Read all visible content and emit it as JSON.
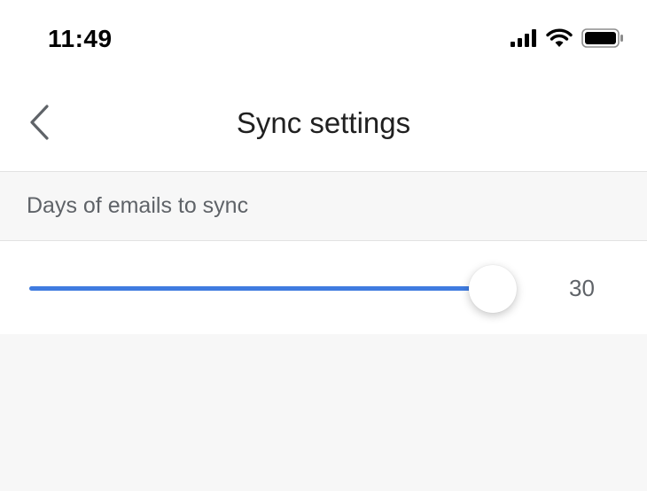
{
  "status_bar": {
    "time": "11:49",
    "icons": [
      "cellular-signal-icon",
      "wifi-icon",
      "battery-icon"
    ]
  },
  "nav": {
    "title": "Sync settings",
    "back_icon": "chevron-left-icon"
  },
  "section": {
    "label": "Days of emails to sync"
  },
  "slider": {
    "value": "30",
    "fill_fraction": 0.95,
    "accent_color": "#3f7be0"
  },
  "colors": {
    "background": "#f7f7f7",
    "surface": "#ffffff",
    "accent": "#3f7be0"
  }
}
